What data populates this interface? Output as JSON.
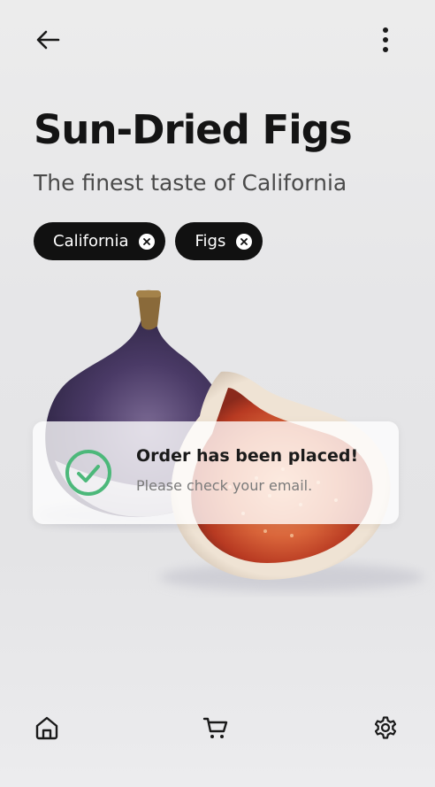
{
  "header": {
    "back_icon": "arrow-left-icon",
    "menu_icon": "more-vertical-icon"
  },
  "product": {
    "title": "Sun-Dried Figs",
    "subtitle": "The finest taste of California"
  },
  "chips": [
    {
      "label": "California",
      "remove_icon": "close-circle-icon"
    },
    {
      "label": "Figs",
      "remove_icon": "close-circle-icon"
    }
  ],
  "toast": {
    "icon": "check-circle-icon",
    "title": "Order has been placed!",
    "message": "Please check your email."
  },
  "bottom_nav": [
    {
      "icon": "home-icon"
    },
    {
      "icon": "cart-icon"
    },
    {
      "icon": "settings-gear-icon"
    }
  ],
  "colors": {
    "chip_background": "#111111",
    "success_green": "#4cb87a",
    "title_text": "#141414"
  }
}
